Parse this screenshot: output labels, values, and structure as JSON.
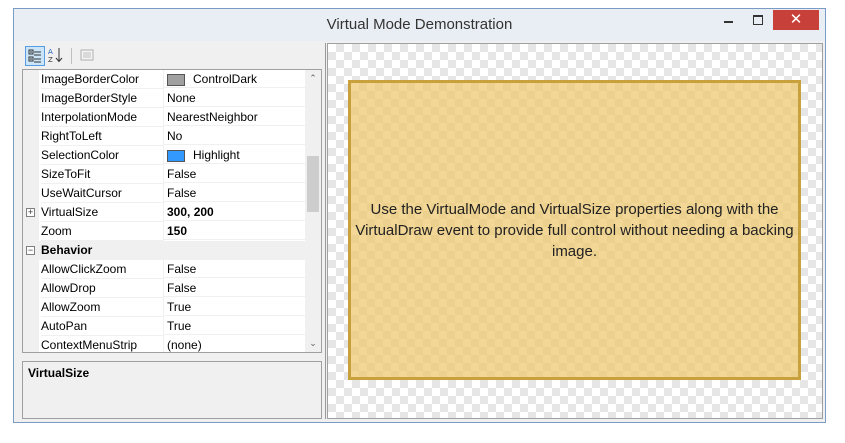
{
  "window": {
    "title": "Virtual Mode Demonstration",
    "minimize": "",
    "maximize": "",
    "close": "✕"
  },
  "toolbar": {
    "categorized_icon": "categorized-icon",
    "alphabetical_icon": "alphabetical-icon",
    "pages_icon": "property-pages-icon"
  },
  "properties": [
    {
      "name": "ImageBorderColor",
      "value": "ControlDark",
      "swatch": "#a0a0a0"
    },
    {
      "name": "ImageBorderStyle",
      "value": "None"
    },
    {
      "name": "InterpolationMode",
      "value": "NearestNeighbor"
    },
    {
      "name": "RightToLeft",
      "value": "No"
    },
    {
      "name": "SelectionColor",
      "value": "Highlight",
      "swatch": "#3399ff"
    },
    {
      "name": "SizeToFit",
      "value": "False"
    },
    {
      "name": "UseWaitCursor",
      "value": "False"
    },
    {
      "name": "VirtualSize",
      "value": "300, 200",
      "bold": true,
      "expandable": true
    },
    {
      "name": "Zoom",
      "value": "150",
      "bold": true
    },
    {
      "name": "Behavior",
      "category": true
    },
    {
      "name": "AllowClickZoom",
      "value": "False"
    },
    {
      "name": "AllowDrop",
      "value": "False"
    },
    {
      "name": "AllowZoom",
      "value": "True"
    },
    {
      "name": "AutoPan",
      "value": "True"
    },
    {
      "name": "ContextMenuStrip",
      "value": "(none)"
    }
  ],
  "scroll": {
    "up": "⌃",
    "down": "⌄"
  },
  "help": {
    "title": "VirtualSize"
  },
  "canvas": {
    "message": "Use the VirtualMode and VirtualSize properties along with the VirtualDraw event to provide full control without needing a backing image."
  }
}
